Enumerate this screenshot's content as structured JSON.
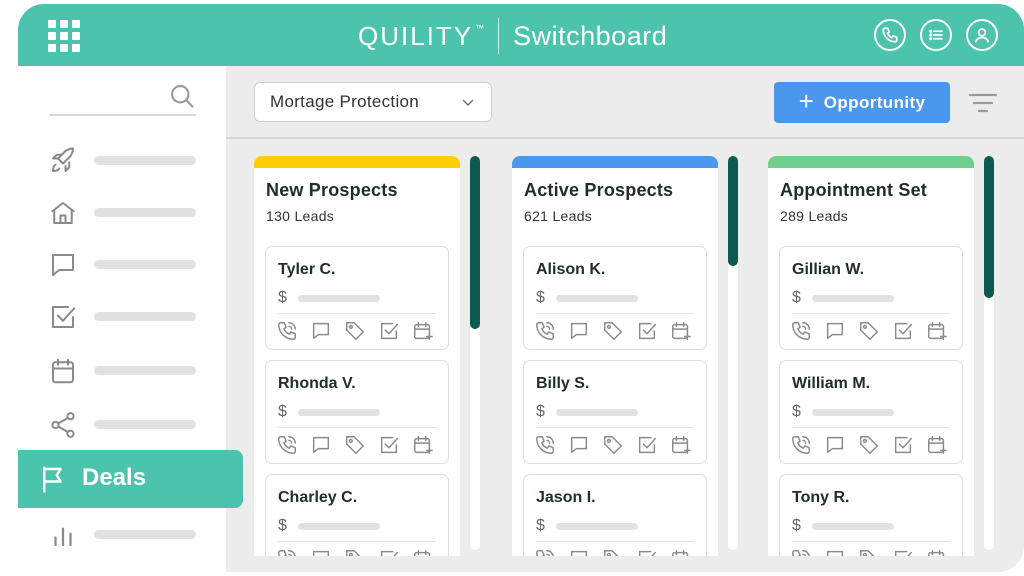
{
  "app": {
    "brand_name": "QUILITY",
    "brand_tm": "™",
    "product_name": "Switchboard"
  },
  "header": {
    "icons": [
      "apps-grid-icon",
      "phone-icon",
      "list-icon",
      "user-icon"
    ],
    "accent_color": "#4cc3ad"
  },
  "sidebar": {
    "search_icon": "search-icon",
    "items": [
      {
        "icon": "rocket-icon"
      },
      {
        "icon": "home-icon"
      },
      {
        "icon": "chat-icon"
      },
      {
        "icon": "checkbox-icon"
      },
      {
        "icon": "calendar-icon"
      },
      {
        "icon": "share-icon"
      },
      {
        "icon": "flag-icon",
        "label": "Deals",
        "active": true
      },
      {
        "icon": "bar-chart-icon"
      }
    ]
  },
  "toolbar": {
    "pipeline_selected": "Mortage Protection",
    "add_button_icon": "+",
    "add_button_label": "Opportunity",
    "add_button_color": "#4c97ee",
    "filter_icon": "filter-icon"
  },
  "columns": [
    {
      "title": "New Prospects",
      "count": "130 Leads",
      "color": "#fdcd06",
      "scroll_fraction": 0.44,
      "cards": [
        {
          "name": "Tyler C.",
          "currency": "$"
        },
        {
          "name": "Rhonda V.",
          "currency": "$"
        },
        {
          "name": "Charley C.",
          "currency": "$"
        }
      ]
    },
    {
      "title": "Active Prospects",
      "count": "621 Leads",
      "color": "#4c97ee",
      "scroll_fraction": 0.28,
      "cards": [
        {
          "name": "Alison K.",
          "currency": "$"
        },
        {
          "name": "Billy S.",
          "currency": "$"
        },
        {
          "name": "Jason I.",
          "currency": "$"
        }
      ]
    },
    {
      "title": "Appointment Set",
      "count": "289 Leads",
      "color": "#6fd08e",
      "scroll_fraction": 0.36,
      "cards": [
        {
          "name": "Gillian W.",
          "currency": "$"
        },
        {
          "name": "William M.",
          "currency": "$"
        },
        {
          "name": "Tony R.",
          "currency": "$"
        }
      ]
    }
  ],
  "card_actions": [
    "call-icon",
    "message-icon",
    "tag-icon",
    "task-icon",
    "schedule-icon"
  ]
}
